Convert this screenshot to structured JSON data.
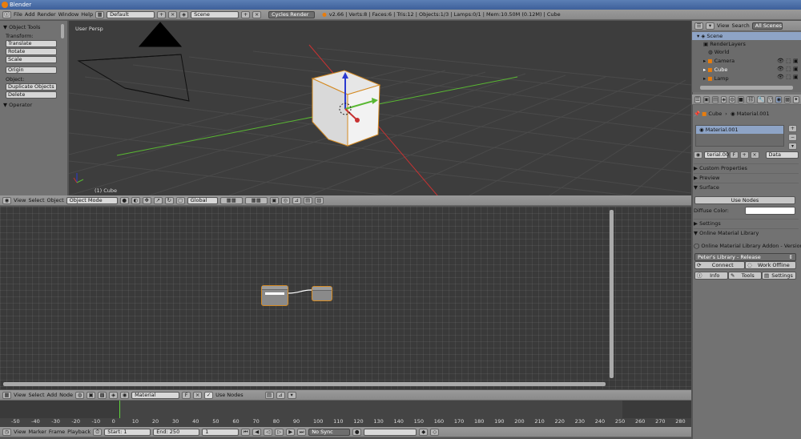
{
  "window": {
    "title": "Blender"
  },
  "info_header": {
    "menus": [
      "File",
      "Add",
      "Render",
      "Window",
      "Help"
    ],
    "layout": "Default",
    "scene": "Scene",
    "engine": "Cycles Render",
    "stats": "v2.66 | Verts:8 | Faces:6 | Tris:12 | Objects:1/3 | Lamps:0/1 | Mem:10.50M (0.12M) | Cube"
  },
  "tool_shelf": {
    "title": "Object Tools",
    "transform_label": "Transform:",
    "transform_buttons": [
      "Translate",
      "Rotate",
      "Scale"
    ],
    "origin_button": "Origin",
    "object_label": "Object:",
    "object_buttons": [
      "Duplicate Objects",
      "Delete"
    ],
    "operator_title": "Operator"
  },
  "viewport": {
    "view_label": "User Persp",
    "object_label": "(1) Cube"
  },
  "viewport_header": {
    "menus": [
      "View",
      "Select",
      "Object"
    ],
    "mode": "Object Mode",
    "orientation": "Global"
  },
  "node_header": {
    "menus": [
      "View",
      "Select",
      "Add",
      "Node"
    ],
    "material": "Material",
    "fake_user": "F",
    "use_nodes_label": "Use Nodes"
  },
  "timeline": {
    "ticks": [
      "-50",
      "-40",
      "-30",
      "-20",
      "-10",
      "0",
      "10",
      "20",
      "30",
      "40",
      "50",
      "60",
      "70",
      "80",
      "90",
      "100",
      "110",
      "120",
      "130",
      "140",
      "150",
      "160",
      "170",
      "180",
      "190",
      "200",
      "210",
      "220",
      "230",
      "240",
      "250",
      "260",
      "270",
      "280"
    ],
    "menus": [
      "View",
      "Marker",
      "Frame",
      "Playback"
    ],
    "start": "Start: 1",
    "end": "End: 250",
    "current": "1",
    "sync": "No Sync"
  },
  "outliner": {
    "menus": [
      "View",
      "Search"
    ],
    "filter": "All Scenes",
    "rows": [
      "Scene",
      "RenderLayers",
      "World",
      "Camera",
      "Cube",
      "Lamp"
    ]
  },
  "properties": {
    "breadcrumb_object": "Cube",
    "breadcrumb_material": "Material.001",
    "slot_material": "Material.001",
    "material_name": "terial.001",
    "fake_user": "F",
    "link": "Data",
    "panels": {
      "custom_properties": "Custom Properties",
      "preview": "Preview",
      "surface": "Surface",
      "settings": "Settings",
      "online_library": "Online Material Library"
    },
    "use_nodes_button": "Use Nodes",
    "diffuse_color_label": "Diffuse Color:",
    "addon_version": "Online Material Library Addon - Version 0.6",
    "library_select": "Peter's Library - Release",
    "connect_button": "Connect",
    "work_offline_button": "Work Offline",
    "tabs": [
      "Info",
      "Tools",
      "Settings"
    ]
  },
  "colors": {
    "accent_blue": "#8ea4c6",
    "node_border": "#d48a22",
    "frame_marker": "#5fd43c",
    "x_axis": "#c83232",
    "y_axis": "#59b832"
  }
}
